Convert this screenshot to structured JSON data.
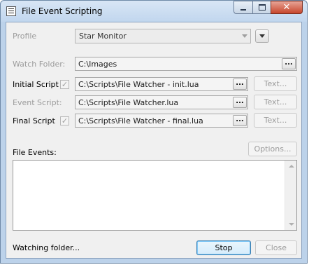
{
  "window": {
    "title": "File Event Scripting"
  },
  "profile": {
    "label": "Profile",
    "value": "Star Monitor"
  },
  "watch_folder": {
    "label": "Watch Folder:",
    "value": "C:\\Images",
    "browse_label": "..."
  },
  "initial_script": {
    "label": "Initial Script",
    "value": "C:\\Scripts\\File Watcher - init.lua",
    "checked": true,
    "browse_label": "...",
    "text_button": "Text..."
  },
  "event_script": {
    "label": "Event Script:",
    "value": "C:\\Scripts\\File Watcher.lua",
    "browse_label": "...",
    "text_button": "Text..."
  },
  "final_script": {
    "label": "Final Script",
    "value": "C:\\Scripts\\File Watcher - final.lua",
    "checked": true,
    "browse_label": "...",
    "text_button": "Text..."
  },
  "file_events": {
    "label": "File Events:",
    "options_button": "Options...",
    "items": []
  },
  "status": {
    "text": "Watching folder..."
  },
  "buttons": {
    "stop": "Stop",
    "close": "Close"
  },
  "colors": {
    "titlebar": "#c1d6ee",
    "close_button": "#c7462c",
    "disabled_text": "#9c9c9c"
  }
}
